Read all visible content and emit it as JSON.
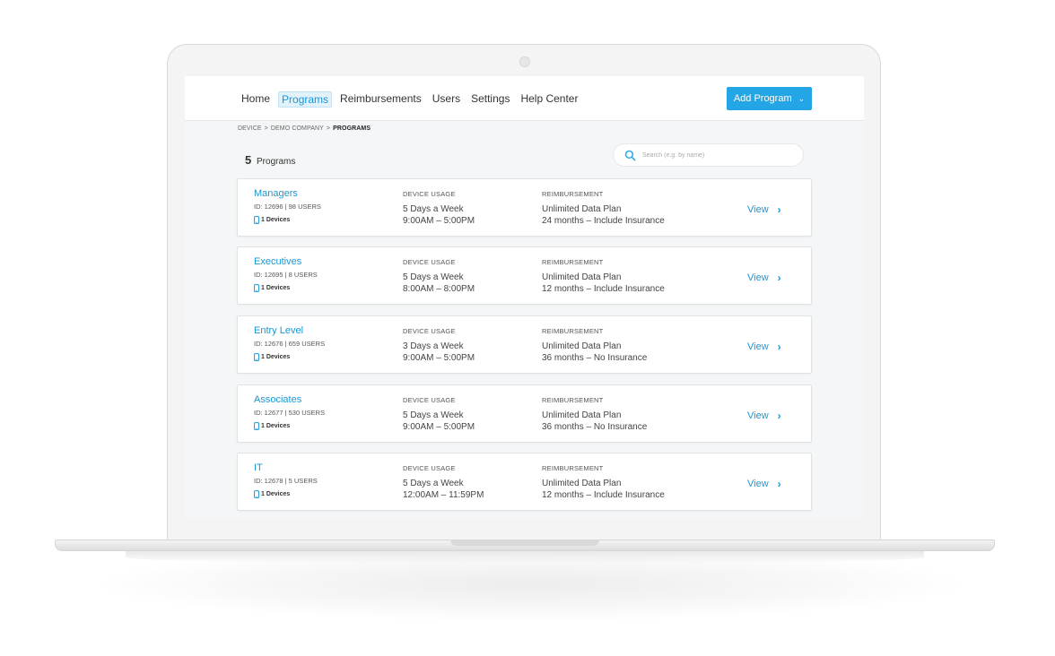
{
  "nav": {
    "items": [
      {
        "label": "Home",
        "active": false
      },
      {
        "label": "Programs",
        "active": true
      },
      {
        "label": "Reimbursements",
        "active": false
      },
      {
        "label": "Users",
        "active": false
      },
      {
        "label": "Settings",
        "active": false
      },
      {
        "label": "Help Center",
        "active": false
      }
    ],
    "add_button_label": "Add Program"
  },
  "breadcrumb": [
    "DEVICE",
    "DEMO COMPANY",
    "PROGRAMS"
  ],
  "breadcrumb_separator": ">",
  "programs_count": "5",
  "programs_count_label": "Programs",
  "search": {
    "placeholder": "Search (e.g. by name)"
  },
  "column_labels": {
    "usage": "DEVICE USAGE",
    "reimbursement": "REIMBURSEMENT"
  },
  "view_label": "View",
  "programs": [
    {
      "name": "Managers",
      "meta": "ID: 12696 | 98 USERS",
      "devices": "1 Devices",
      "usage_days": "5 Days a Week",
      "usage_hours": "9:00AM – 5:00PM",
      "plan": "Unlimited Data Plan",
      "term": "24 months – Include Insurance"
    },
    {
      "name": "Executives",
      "meta": "ID: 12695 | 8 USERS",
      "devices": "1 Devices",
      "usage_days": "5 Days a Week",
      "usage_hours": "8:00AM – 8:00PM",
      "plan": "Unlimited Data Plan",
      "term": "12 months – Include Insurance"
    },
    {
      "name": "Entry Level",
      "meta": "ID: 12676 | 659 USERS",
      "devices": "1 Devices",
      "usage_days": "3 Days a Week",
      "usage_hours": "9:00AM – 5:00PM",
      "plan": "Unlimited Data Plan",
      "term": "36 months – No Insurance"
    },
    {
      "name": "Associates",
      "meta": "ID: 12677 | 530 USERS",
      "devices": "1 Devices",
      "usage_days": "5 Days a Week",
      "usage_hours": "9:00AM – 5:00PM",
      "plan": "Unlimited Data Plan",
      "term": "36 months – No Insurance"
    },
    {
      "name": "IT",
      "meta": "ID: 12678 | 5 USERS",
      "devices": "1 Devices",
      "usage_days": "5 Days a Week",
      "usage_hours": "12:00AM – 11:59PM",
      "plan": "Unlimited Data Plan",
      "term": "12 months – Include Insurance"
    }
  ],
  "icons": {
    "search": "search-icon",
    "phone": "phone-icon",
    "view_chevron": "chevron-right-icon",
    "add_chevron": "chevron-down-icon"
  },
  "colors": {
    "accent": "#24a6e6",
    "link": "#1a97d6"
  }
}
